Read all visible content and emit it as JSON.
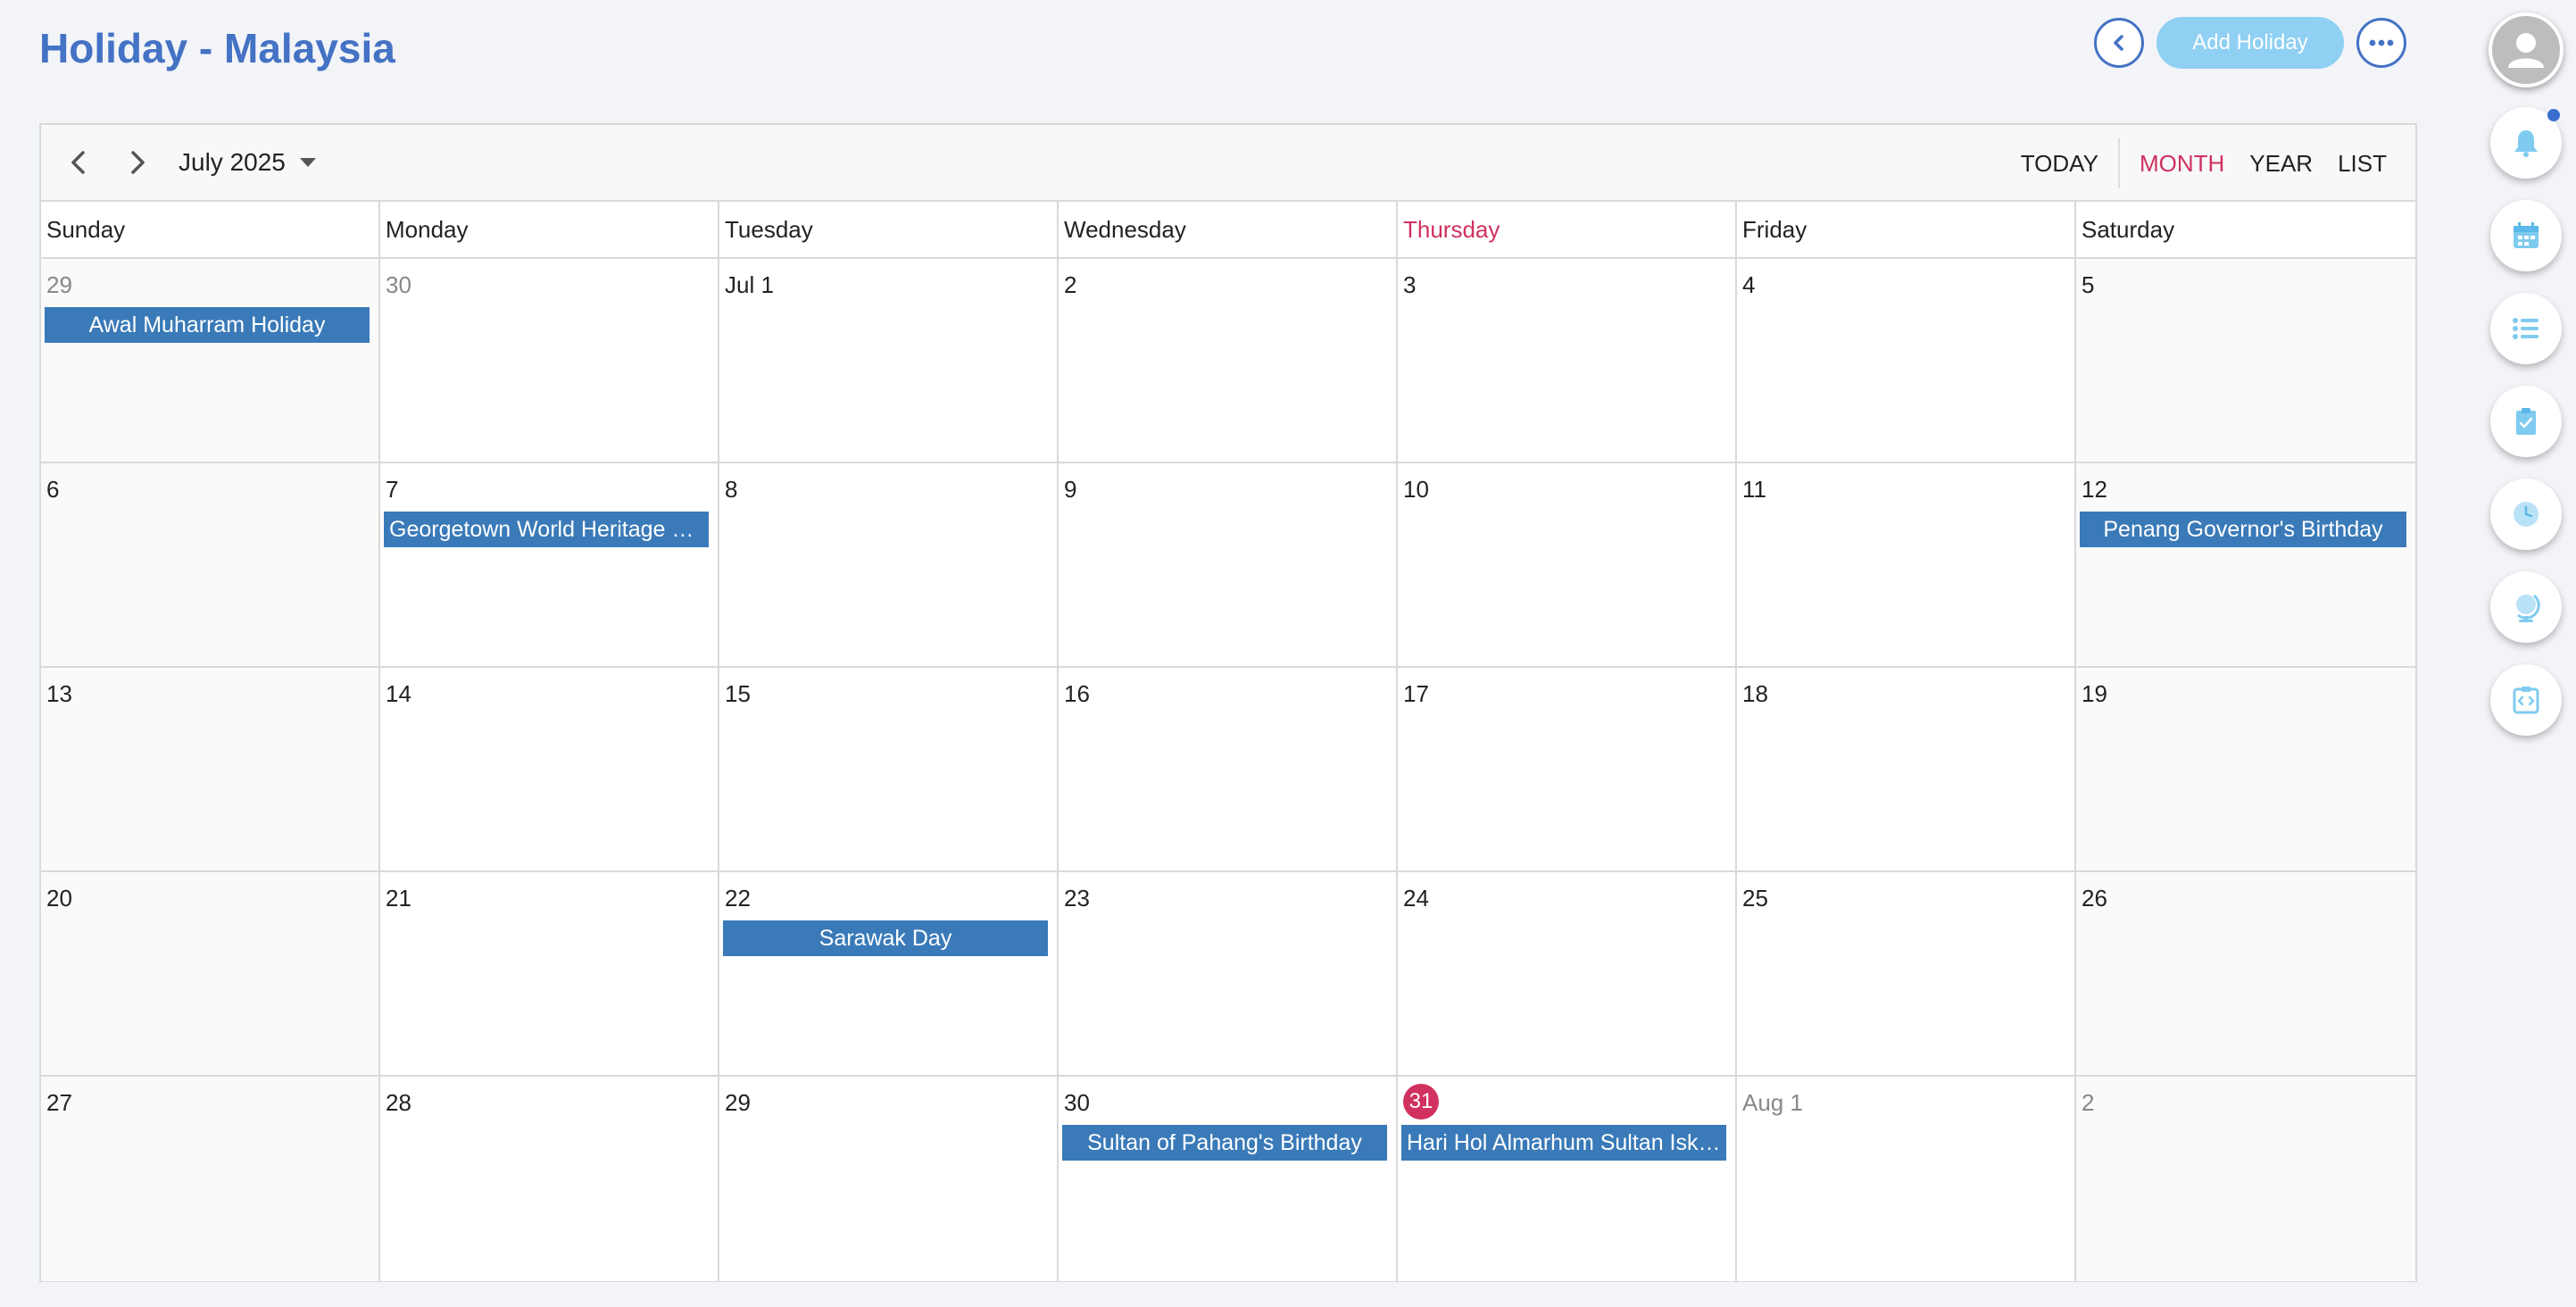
{
  "header": {
    "title": "Holiday - Malaysia",
    "add_label": "Add Holiday"
  },
  "toolbar": {
    "month_label": "July 2025",
    "views": [
      "TODAY",
      "MONTH",
      "YEAR",
      "LIST"
    ],
    "active_view": "MONTH"
  },
  "weekdays": [
    "Sunday",
    "Monday",
    "Tuesday",
    "Wednesday",
    "Thursday",
    "Friday",
    "Saturday"
  ],
  "weeks": [
    [
      {
        "label": "29",
        "other": true,
        "event": "Awal Muharram Holiday"
      },
      {
        "label": "30",
        "other": true
      },
      {
        "label": "Jul 1"
      },
      {
        "label": "2"
      },
      {
        "label": "3"
      },
      {
        "label": "4"
      },
      {
        "label": "5"
      }
    ],
    [
      {
        "label": "6"
      },
      {
        "label": "7",
        "event": "Georgetown World Heritage City Day"
      },
      {
        "label": "8"
      },
      {
        "label": "9"
      },
      {
        "label": "10"
      },
      {
        "label": "11"
      },
      {
        "label": "12",
        "event": "Penang Governor's Birthday"
      }
    ],
    [
      {
        "label": "13"
      },
      {
        "label": "14"
      },
      {
        "label": "15"
      },
      {
        "label": "16"
      },
      {
        "label": "17"
      },
      {
        "label": "18"
      },
      {
        "label": "19"
      }
    ],
    [
      {
        "label": "20"
      },
      {
        "label": "21"
      },
      {
        "label": "22",
        "event": "Sarawak Day"
      },
      {
        "label": "23"
      },
      {
        "label": "24"
      },
      {
        "label": "25"
      },
      {
        "label": "26"
      }
    ],
    [
      {
        "label": "27"
      },
      {
        "label": "28"
      },
      {
        "label": "29"
      },
      {
        "label": "30",
        "event": "Sultan of Pahang's Birthday"
      },
      {
        "label": "31",
        "today": true,
        "event": "Hari Hol Almarhum Sultan Iskandar"
      },
      {
        "label": "Aug 1",
        "other": true
      },
      {
        "label": "2",
        "other": true
      }
    ]
  ],
  "today_weekday_index": 4,
  "colors": {
    "accent": "#4472c4",
    "today": "#d0315f",
    "event": "#3a7ab8",
    "add_button": "#8fd0f3"
  },
  "right_rail": [
    "avatar-icon",
    "bell-icon",
    "calendar-icon",
    "list-icon",
    "clipboard-check-icon",
    "clock-icon",
    "globe-icon",
    "code-icon"
  ]
}
